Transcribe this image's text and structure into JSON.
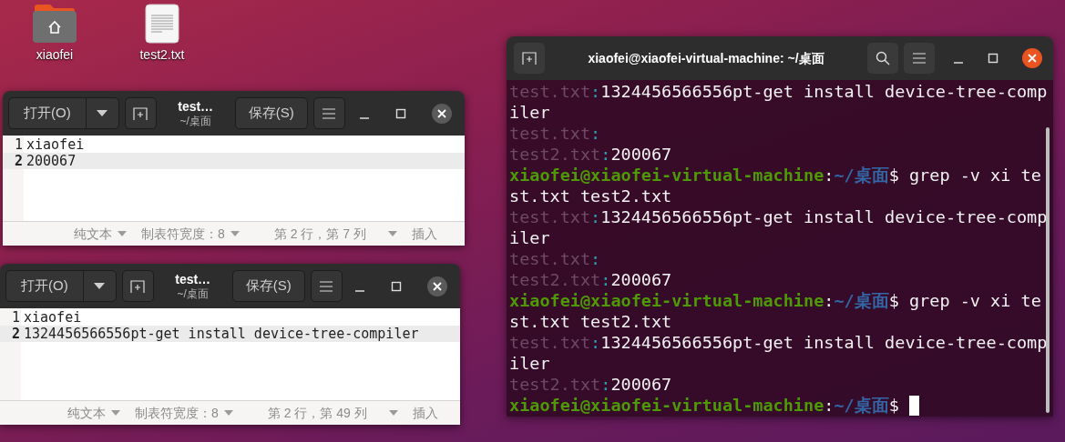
{
  "desktop_icons": [
    {
      "kind": "folder",
      "label": "xiaofei"
    },
    {
      "kind": "file",
      "label": "test2.txt"
    }
  ],
  "editors": [
    {
      "title": "test…",
      "subtitle": "~/桌面",
      "open_button": "打开(O)",
      "save_button": "保存(S)",
      "lines": [
        {
          "number": "1",
          "text": "xiaofei",
          "current": false
        },
        {
          "number": "2",
          "text": "200067",
          "current": true
        }
      ],
      "status": {
        "language": "纯文本",
        "tab_width": "制表符宽度：8",
        "position": "第 2 行，第 7 列",
        "mode": "插入"
      }
    },
    {
      "title": "test…",
      "subtitle": "~/桌面",
      "open_button": "打开(O)",
      "save_button": "保存(S)",
      "lines": [
        {
          "number": "1",
          "text": "xiaofei",
          "current": false
        },
        {
          "number": "2",
          "text": "1324456566556pt-get install device-tree-compiler",
          "current": true
        }
      ],
      "status": {
        "language": "纯文本",
        "tab_width": "制表符宽度：8",
        "position": "第 2 行，第 49 列",
        "mode": "插入"
      }
    }
  ],
  "terminal": {
    "title": "xiaofei@xiaofei-virtual-machine: ~/桌面",
    "lines": [
      [
        {
          "kind": "file",
          "text": "test.txt"
        },
        {
          "kind": "sep",
          "text": ":"
        },
        {
          "kind": "out",
          "text": "1324456566556pt-get install device-tree-comp"
        }
      ],
      [
        {
          "kind": "out",
          "text": "iler"
        }
      ],
      [
        {
          "kind": "file",
          "text": "test.txt"
        },
        {
          "kind": "sep",
          "text": ":"
        }
      ],
      [
        {
          "kind": "file",
          "text": "test2.txt"
        },
        {
          "kind": "sep",
          "text": ":"
        },
        {
          "kind": "out",
          "text": "200067"
        }
      ],
      [
        {
          "kind": "user",
          "text": "xiaofei@xiaofei-virtual-machine"
        },
        {
          "kind": "out",
          "text": ":"
        },
        {
          "kind": "path",
          "text": "~/桌面"
        },
        {
          "kind": "out",
          "text": "$ grep -v xi te"
        }
      ],
      [
        {
          "kind": "out",
          "text": "st.txt test2.txt"
        }
      ],
      [
        {
          "kind": "file",
          "text": "test.txt"
        },
        {
          "kind": "sep",
          "text": ":"
        },
        {
          "kind": "out",
          "text": "1324456566556pt-get install device-tree-comp"
        }
      ],
      [
        {
          "kind": "out",
          "text": "iler"
        }
      ],
      [
        {
          "kind": "file",
          "text": "test.txt"
        },
        {
          "kind": "sep",
          "text": ":"
        }
      ],
      [
        {
          "kind": "file",
          "text": "test2.txt"
        },
        {
          "kind": "sep",
          "text": ":"
        },
        {
          "kind": "out",
          "text": "200067"
        }
      ],
      [
        {
          "kind": "user",
          "text": "xiaofei@xiaofei-virtual-machine"
        },
        {
          "kind": "out",
          "text": ":"
        },
        {
          "kind": "path",
          "text": "~/桌面"
        },
        {
          "kind": "out",
          "text": "$ grep -v xi te"
        }
      ],
      [
        {
          "kind": "out",
          "text": "st.txt test2.txt"
        }
      ],
      [
        {
          "kind": "file",
          "text": "test.txt"
        },
        {
          "kind": "sep",
          "text": ":"
        },
        {
          "kind": "out",
          "text": "1324456566556pt-get install device-tree-comp"
        }
      ],
      [
        {
          "kind": "out",
          "text": "iler"
        }
      ],
      [
        {
          "kind": "file",
          "text": "test2.txt"
        },
        {
          "kind": "sep",
          "text": ":"
        },
        {
          "kind": "out",
          "text": "200067"
        }
      ],
      [
        {
          "kind": "user",
          "text": "xiaofei@xiaofei-virtual-machine"
        },
        {
          "kind": "out",
          "text": ":"
        },
        {
          "kind": "path",
          "text": "~/桌面"
        },
        {
          "kind": "out",
          "text": "$ "
        },
        {
          "kind": "cursor"
        }
      ]
    ]
  }
}
